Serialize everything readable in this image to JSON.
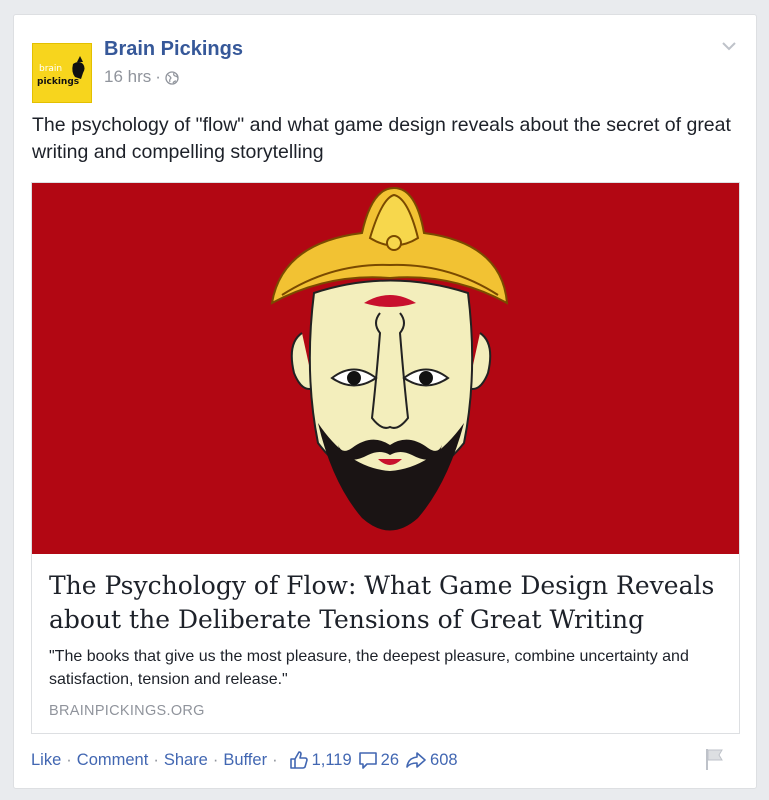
{
  "post": {
    "page_name": "Brain Pickings",
    "avatar_text_top": "brain",
    "avatar_text_bottom": "pickings",
    "time": "16 hrs",
    "time_separator": "·",
    "privacy_icon": "globe-icon",
    "text": "The psychology of \"flow\" and what game design reveals about the secret of great writing and compelling storytelling"
  },
  "link": {
    "title": "The Psychology of Flow: What Game Design Reveals about the Deliberate Tensions of Great Writing",
    "description": "\"The books that give us the most pleasure, the deepest pleasure, combine uncertainty and satisfaction, tension and release.\"",
    "domain": "BRAINPICKINGS.ORG"
  },
  "actions": {
    "like": "Like",
    "comment": "Comment",
    "share": "Share",
    "buffer": "Buffer",
    "separator": "·",
    "likes_count": "1,119",
    "comments_count": "26",
    "shares_count": "608"
  },
  "colors": {
    "link_blue": "#365899",
    "image_red": "#b20713",
    "avatar_yellow": "#f7d51d",
    "muted_gray": "#90949c"
  }
}
